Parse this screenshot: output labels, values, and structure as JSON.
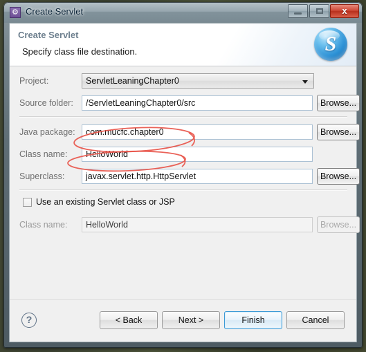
{
  "window": {
    "title": "Create Servlet",
    "icon": "gear-icon",
    "controls": {
      "minimize": "minimize-icon",
      "maximize": "maximize-icon",
      "close_label": "x"
    }
  },
  "header": {
    "title": "Create Servlet",
    "subtitle": "Specify class file destination.",
    "icon": "servlet-wizard-icon",
    "icon_glyph": "S"
  },
  "form": {
    "project": {
      "label": "Project:",
      "value": "ServletLeaningChapter0",
      "control": "combobox"
    },
    "source_folder": {
      "label": "Source folder:",
      "value": "/ServletLeaningChapter0/src",
      "browse": "Browse..."
    },
    "java_package": {
      "label": "Java package:",
      "value": "com.mucfc.chapter0",
      "browse": "Browse..."
    },
    "class_name": {
      "label": "Class name:",
      "value": "HelloWorld"
    },
    "superclass": {
      "label": "Superclass:",
      "value": "javax.servlet.http.HttpServlet",
      "browse": "Browse..."
    },
    "use_existing": {
      "label": "Use an existing Servlet class or JSP",
      "checked": false
    },
    "existing_class_name": {
      "label": "Class name:",
      "value": "HelloWorld",
      "browse": "Browse...",
      "disabled": true
    }
  },
  "footer": {
    "help": "?",
    "back": "< Back",
    "next": "Next >",
    "finish": "Finish",
    "cancel": "Cancel"
  },
  "annotations": {
    "color": "#e8554a",
    "ellipses": [
      {
        "name": "java-package-highlight"
      },
      {
        "name": "class-name-highlight"
      }
    ]
  }
}
